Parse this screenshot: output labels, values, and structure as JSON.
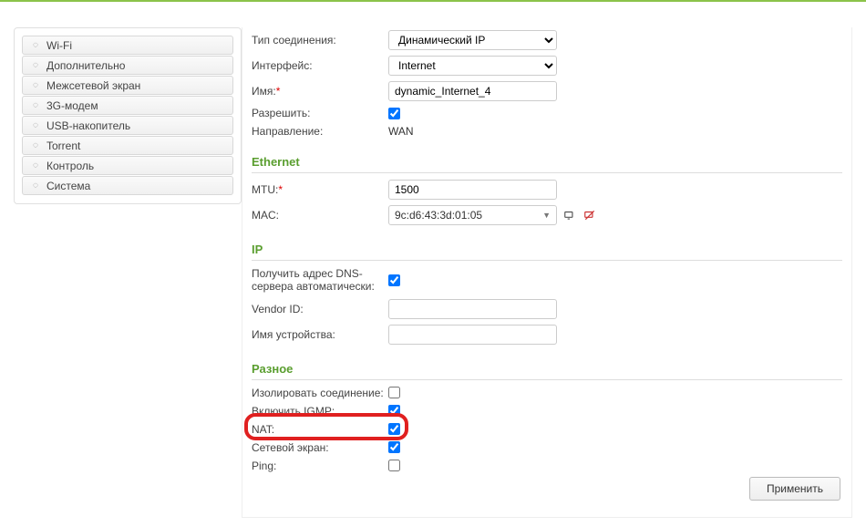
{
  "sidebar": {
    "items": [
      {
        "label": "Wi-Fi"
      },
      {
        "label": "Дополнительно"
      },
      {
        "label": "Межсетевой экран"
      },
      {
        "label": "3G-модем"
      },
      {
        "label": "USB-накопитель"
      },
      {
        "label": "Torrent"
      },
      {
        "label": "Контроль"
      },
      {
        "label": "Система"
      }
    ]
  },
  "sections": {
    "ethernet": "Ethernet",
    "ip": "IP",
    "misc": "Разное"
  },
  "labels": {
    "conn_type": "Тип соединения:",
    "interface": "Интерфейс:",
    "name": "Имя:",
    "allow": "Разрешить:",
    "direction": "Направление:",
    "mtu": "MTU:",
    "mac": "MAC:",
    "dns_auto": "Получить адрес DNS-сервера автоматически:",
    "vendor_id": "Vendor ID:",
    "device_name": "Имя устройства:",
    "isolate": "Изолировать соединение:",
    "igmp": "Включить IGMP:",
    "nat": "NAT:",
    "fw": "Сетевой экран:",
    "ping": "Ping:"
  },
  "values": {
    "conn_type": "Динамический IP",
    "interface": "Internet",
    "name": "dynamic_Internet_4",
    "allow": true,
    "direction": "WAN",
    "mtu": "1500",
    "mac": "9c:d6:43:3d:01:05",
    "dns_auto": true,
    "vendor_id": "",
    "device_name": "",
    "isolate": false,
    "igmp": true,
    "nat": true,
    "fw": true,
    "ping": false
  },
  "buttons": {
    "apply": "Применить"
  }
}
